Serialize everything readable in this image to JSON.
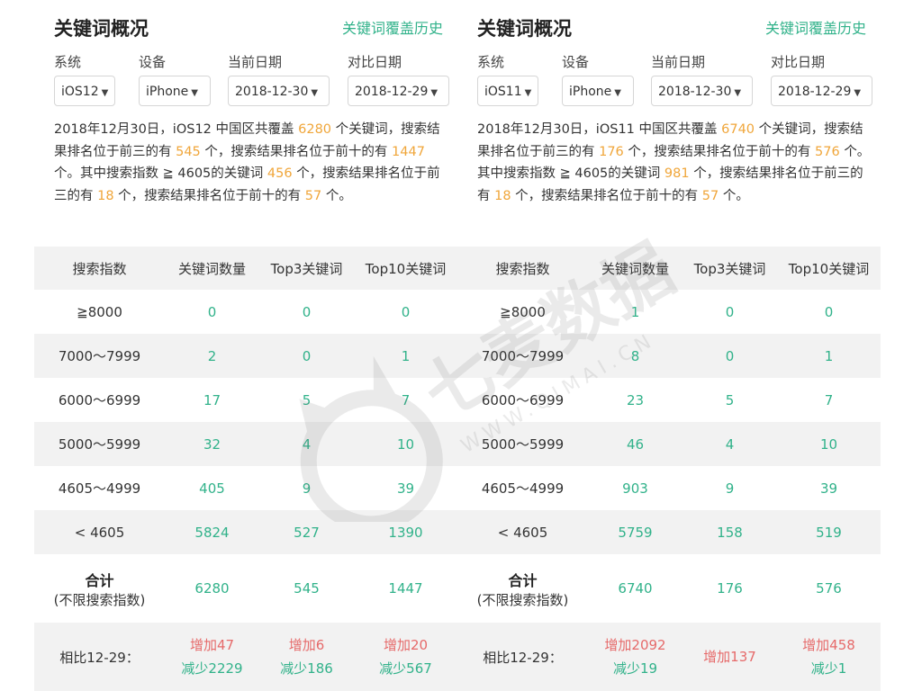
{
  "panels": [
    {
      "title": "关键词概况",
      "history_link": "关键词覆盖历史",
      "filters": {
        "system": {
          "label": "系统",
          "value": "iOS12"
        },
        "device": {
          "label": "设备",
          "value": "iPhone"
        },
        "current_date": {
          "label": "当前日期",
          "value": "2018-12-30"
        },
        "compare_date": {
          "label": "对比日期",
          "value": "2018-12-29"
        }
      },
      "summary": {
        "p1": "2018年12月30日，iOS12 中国区共覆盖",
        "v1": "6280",
        "p2": "个关键词，搜索结果排名位于前三的有",
        "v2": "545",
        "p3": "个，搜索结果排名位于前十的有",
        "v3": "1447",
        "p4": "个。其中搜索指数 ≧ 4605的关键词",
        "v4": "456",
        "p5": "个，搜索结果排名位于前三的有",
        "v5": "18",
        "p6": "个，搜索结果排名位于前十的有",
        "v6": "57",
        "p7": "个。"
      },
      "table": {
        "headers": [
          "搜索指数",
          "关键词数量",
          "Top3关键词",
          "Top10关键词"
        ],
        "rows": [
          {
            "range": "≧8000",
            "count": "0",
            "top3": "0",
            "top10": "0"
          },
          {
            "range": "7000～7999",
            "count": "2",
            "top3": "0",
            "top10": "1"
          },
          {
            "range": "6000～6999",
            "count": "17",
            "top3": "5",
            "top10": "7"
          },
          {
            "range": "5000～5999",
            "count": "32",
            "top3": "4",
            "top10": "10"
          },
          {
            "range": "4605～4999",
            "count": "405",
            "top3": "9",
            "top10": "39"
          },
          {
            "range": "< 4605",
            "count": "5824",
            "top3": "527",
            "top10": "1390"
          }
        ],
        "total": {
          "label": "合计",
          "sublabel": "(不限搜索指数)",
          "count": "6280",
          "top3": "545",
          "top10": "1447"
        },
        "compare": {
          "label": "相比12-29：",
          "count": {
            "inc": "增加47",
            "dec": "减少2229"
          },
          "top3": {
            "inc": "增加6",
            "dec": "减少186"
          },
          "top10": {
            "inc": "增加20",
            "dec": "减少567"
          }
        }
      }
    },
    {
      "title": "关键词概况",
      "history_link": "关键词覆盖历史",
      "filters": {
        "system": {
          "label": "系统",
          "value": "iOS11"
        },
        "device": {
          "label": "设备",
          "value": "iPhone"
        },
        "current_date": {
          "label": "当前日期",
          "value": "2018-12-30"
        },
        "compare_date": {
          "label": "对比日期",
          "value": "2018-12-29"
        }
      },
      "summary": {
        "p1": "2018年12月30日，iOS11 中国区共覆盖",
        "v1": "6740",
        "p2": "个关键词，搜索结果排名位于前三的有",
        "v2": "176",
        "p3": "个，搜索结果排名位于前十的有",
        "v3": "576",
        "p4": "个。其中搜索指数 ≧ 4605的关键词",
        "v4": "981",
        "p5": "个，搜索结果排名位于前三的有",
        "v5": "18",
        "p6": "个，搜索结果排名位于前十的有",
        "v6": "57",
        "p7": "个。"
      },
      "table": {
        "headers": [
          "搜索指数",
          "关键词数量",
          "Top3关键词",
          "Top10关键词"
        ],
        "rows": [
          {
            "range": "≧8000",
            "count": "1",
            "top3": "0",
            "top10": "0"
          },
          {
            "range": "7000～7999",
            "count": "8",
            "top3": "0",
            "top10": "1"
          },
          {
            "range": "6000～6999",
            "count": "23",
            "top3": "5",
            "top10": "7"
          },
          {
            "range": "5000～5999",
            "count": "46",
            "top3": "4",
            "top10": "10"
          },
          {
            "range": "4605～4999",
            "count": "903",
            "top3": "9",
            "top10": "39"
          },
          {
            "range": "< 4605",
            "count": "5759",
            "top3": "158",
            "top10": "519"
          }
        ],
        "total": {
          "label": "合计",
          "sublabel": "(不限搜索指数)",
          "count": "6740",
          "top3": "176",
          "top10": "576"
        },
        "compare": {
          "label": "相比12-29：",
          "count": {
            "inc": "增加2092",
            "dec": "减少19"
          },
          "top3": {
            "inc": "增加137",
            "dec": ""
          },
          "top10": {
            "inc": "增加458",
            "dec": "减少1"
          }
        }
      }
    }
  ],
  "watermark": {
    "text": "七麦数据",
    "url": "WWW.QIMAI.CN"
  },
  "colors": {
    "accent": "#31b28a",
    "highlight": "#f0a63a",
    "increase": "#e66a6a",
    "row_alt": "#f2f2f2"
  }
}
